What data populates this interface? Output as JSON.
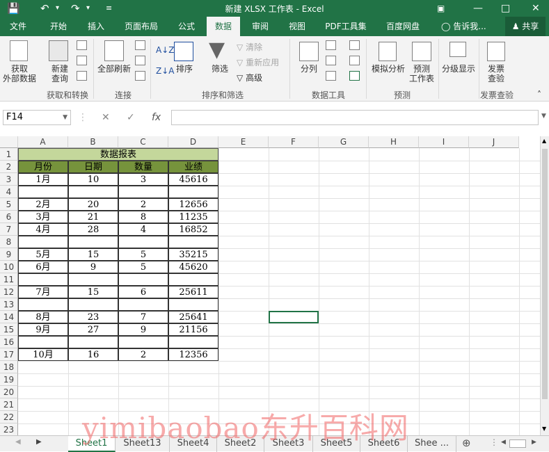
{
  "window": {
    "title": "新建 XLSX 工作表 - Excel"
  },
  "ribbon_tabs": [
    "文件",
    "开始",
    "插入",
    "页面布局",
    "公式",
    "数据",
    "审阅",
    "视图",
    "PDF工具集",
    "百度网盘"
  ],
  "active_tab": "数据",
  "tell_me": "告诉我...",
  "share": "共享",
  "ribbon": {
    "get_external": "获取\n外部数据",
    "new_query": "新建\n查询",
    "refresh_all": "全部刷新",
    "sort": "排序",
    "filter": "筛选",
    "clear": "清除",
    "reapply": "重新应用",
    "advanced": "高级",
    "text_to_columns": "分列",
    "what_if": "模拟分析",
    "forecast": "预测\n工作表",
    "outline": "分级显示",
    "invoice": "发票\n查验",
    "groups": {
      "get_transform": "获取和转换",
      "connections": "连接",
      "sort_filter": "排序和筛选",
      "data_tools": "数据工具",
      "forecast": "预测",
      "invoice": "发票查验"
    }
  },
  "formula_bar": {
    "name_box": "F14",
    "fx": "fx",
    "value": ""
  },
  "columns": [
    "A",
    "B",
    "C",
    "D",
    "E",
    "F",
    "G",
    "H",
    "I",
    "J"
  ],
  "rows": [
    "1",
    "2",
    "3",
    "4",
    "5",
    "6",
    "7",
    "8",
    "9",
    "10",
    "11",
    "12",
    "13",
    "14",
    "15",
    "16",
    "17",
    "18",
    "19",
    "20",
    "21",
    "22",
    "23"
  ],
  "table": {
    "title": "数据报表",
    "headers": [
      "月份",
      "日期",
      "数量",
      "业绩"
    ],
    "rows": [
      [
        "1月",
        "10",
        "3",
        "45616"
      ],
      [
        "",
        "",
        "",
        ""
      ],
      [
        "2月",
        "20",
        "2",
        "12656"
      ],
      [
        "3月",
        "21",
        "8",
        "11235"
      ],
      [
        "4月",
        "28",
        "4",
        "16852"
      ],
      [
        "",
        "",
        "",
        ""
      ],
      [
        "5月",
        "15",
        "5",
        "35215"
      ],
      [
        "6月",
        "9",
        "5",
        "45620"
      ],
      [
        "",
        "",
        "",
        ""
      ],
      [
        "7月",
        "15",
        "6",
        "25611"
      ],
      [
        "",
        "",
        "",
        ""
      ],
      [
        "8月",
        "23",
        "7",
        "25641"
      ],
      [
        "9月",
        "27",
        "9",
        "21156"
      ],
      [
        "",
        "",
        "",
        ""
      ],
      [
        "10月",
        "16",
        "2",
        "12356"
      ]
    ]
  },
  "sheets": [
    "Sheet1",
    "Sheet13",
    "Sheet4",
    "Sheet2",
    "Sheet3",
    "Sheet5",
    "Sheet6",
    "Shee ..."
  ],
  "active_sheet": "Sheet1",
  "watermark": "yimibaobao东升百科网",
  "colors": {
    "excel_green": "#217346",
    "title_fill": "#c4d79b",
    "header_fill": "#76933c"
  }
}
